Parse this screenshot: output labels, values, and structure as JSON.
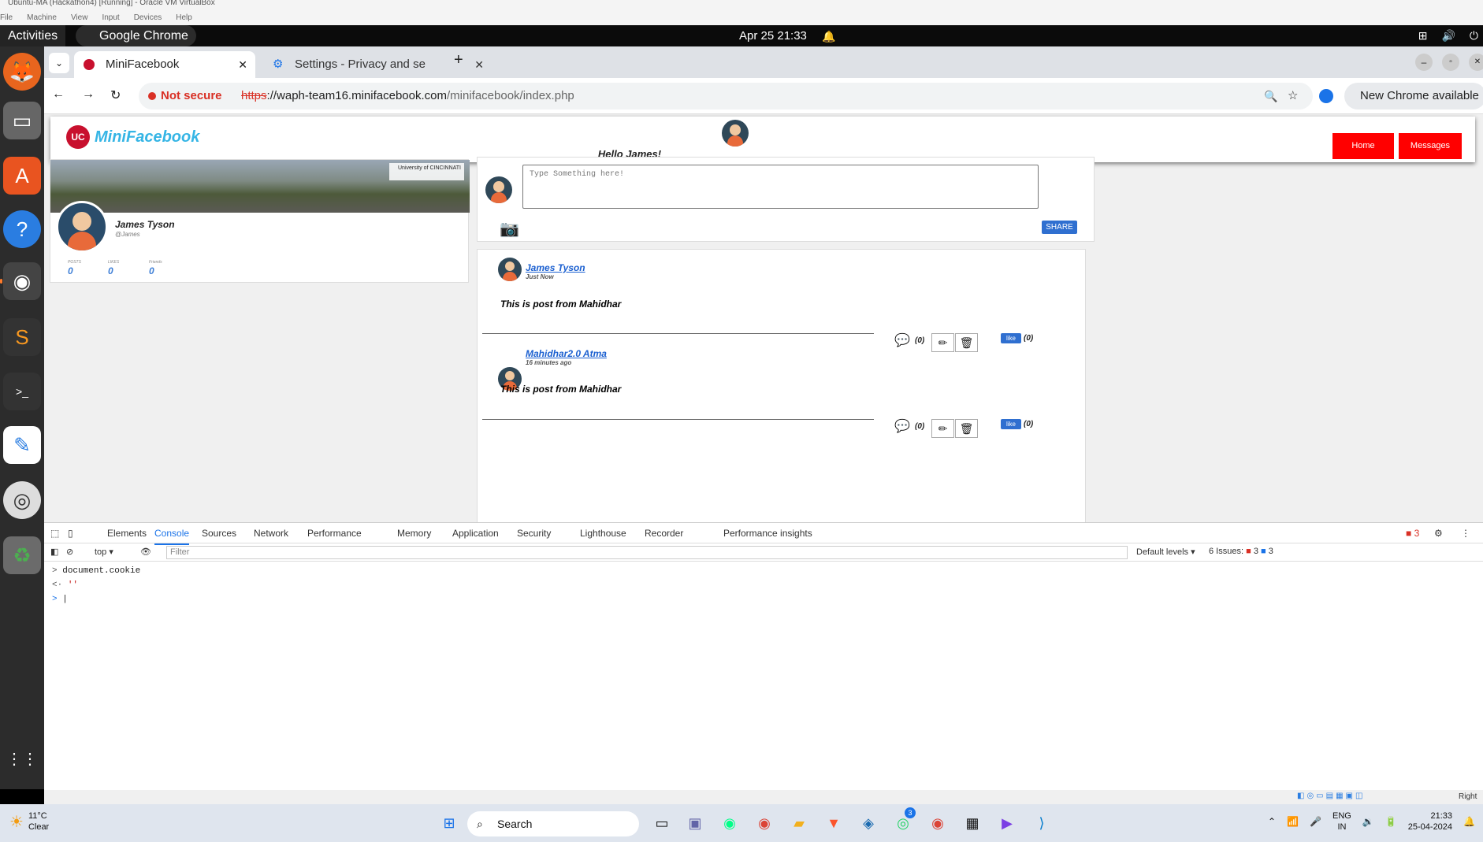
{
  "vbox": {
    "title": "Ubuntu-MA (Hackathon4) [Running] - Oracle VM VirtualBox",
    "menu": [
      "File",
      "Machine",
      "View",
      "Input",
      "Devices",
      "Help"
    ]
  },
  "topbar": {
    "activities": "Activities",
    "app": "Google Chrome",
    "clock": "Apr 25  21:33"
  },
  "chrome": {
    "tabs": [
      {
        "label": "MiniFacebook"
      },
      {
        "label": "Settings - Privacy and se"
      }
    ],
    "not_secure": "Not secure",
    "url_scheme": "https",
    "url_host": "://waph-team16.minifacebook.com",
    "url_path": "/minifacebook/index.php",
    "new_chrome": "New Chrome available"
  },
  "site": {
    "brand": "MiniFacebook",
    "greeting": "Hello James!",
    "nav": [
      "Home",
      "Messages"
    ],
    "banner_text": "University of CINCINNATI",
    "profile": {
      "name": "James Tyson",
      "handle": "@James",
      "stats": [
        {
          "label": "POSTS",
          "value": "0"
        },
        {
          "label": "LIKES",
          "value": "0"
        },
        {
          "label": "Friends",
          "value": "0"
        }
      ]
    },
    "composer": {
      "placeholder": "Type Something here!",
      "share": "SHARE"
    },
    "posts": [
      {
        "author": "James Tyson",
        "time": "Just Now",
        "body": "This is post from Mahidhar",
        "comments": "(0)",
        "like": "like",
        "likes": "(0)"
      },
      {
        "author": "Mahidhar2.0 Atma",
        "time": "16 minutes ago",
        "body": "This is post from Mahidhar",
        "comments": "(0)",
        "like": "like",
        "likes": "(0)"
      }
    ]
  },
  "devtools": {
    "tabs": [
      "Elements",
      "Console",
      "Sources",
      "Network",
      "Performance",
      "Memory",
      "Application",
      "Security",
      "Lighthouse",
      "Recorder",
      "Performance insights"
    ],
    "errors_count": "3",
    "context": "top",
    "filter_placeholder": "Filter",
    "levels": "Default levels",
    "issues_label": "6 Issues:",
    "issues_err": "3",
    "issues_info": "3",
    "console": [
      {
        "prefix": ">",
        "text": "document.cookie"
      },
      {
        "prefix": "<·",
        "text": "''"
      },
      {
        "prefix": ">",
        "text": "|"
      }
    ]
  },
  "vbox_status": {
    "host_key": "Right"
  },
  "taskbar": {
    "temp": "11°C",
    "weather": "Clear",
    "search": "Search",
    "lang1": "ENG",
    "lang2": "IN",
    "time": "21:33",
    "date": "25-04-2024",
    "whatsapp_badge": "3"
  }
}
